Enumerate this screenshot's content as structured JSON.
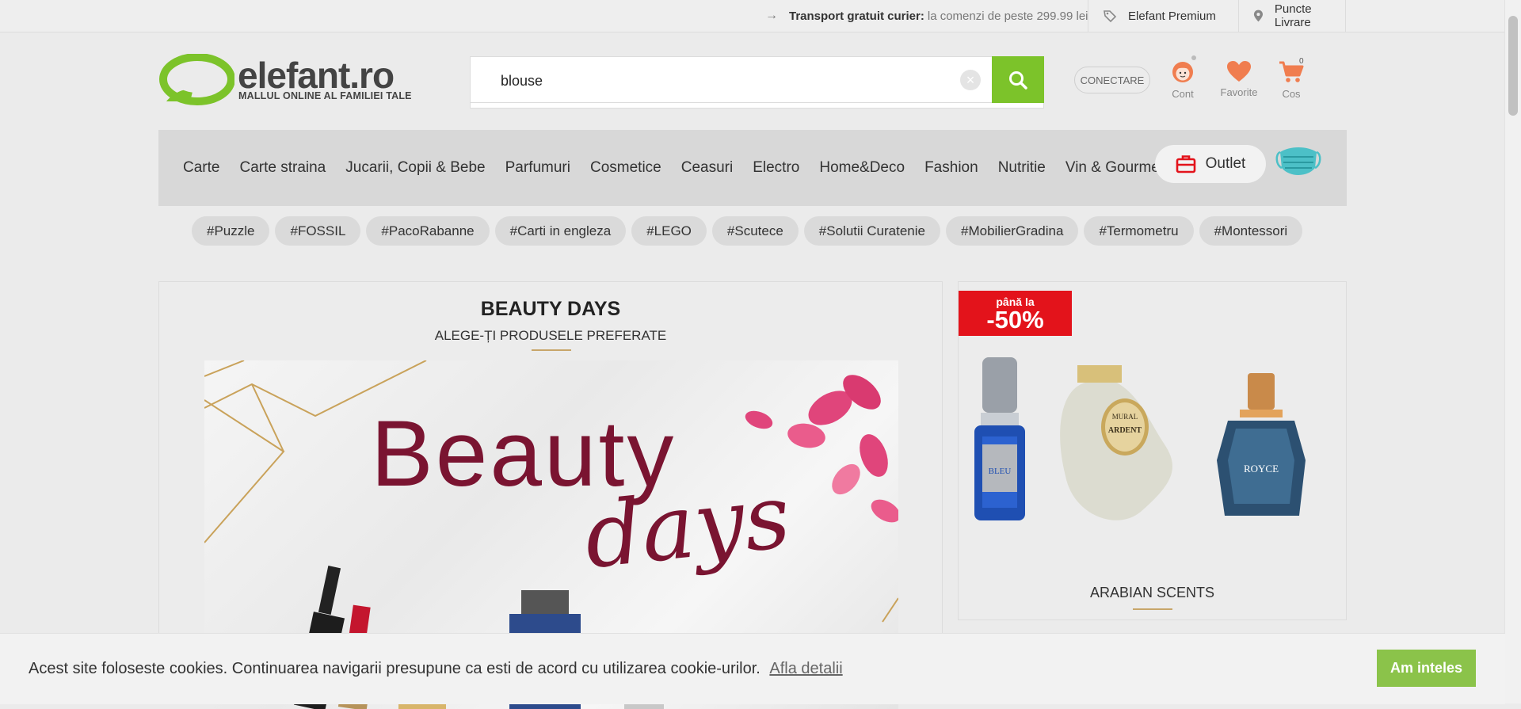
{
  "topbar": {
    "shipping_bold": "Transport gratuit curier:",
    "shipping_text": "la comenzi de peste 299.99 lei",
    "premium": "Elefant Premium",
    "puncte": "Puncte Livrare"
  },
  "logo": {
    "brand": "elefant.ro",
    "tagline": "MALLUL ONLINE AL FAMILIEI TALE"
  },
  "search": {
    "value": "blouse",
    "clear_icon": "×"
  },
  "user": {
    "conectare": "CONECTARE",
    "cont": "Cont",
    "favorite": "Favorite",
    "cos": "Cos",
    "cart_count": "0"
  },
  "nav": {
    "items": [
      "Carte",
      "Carte straina",
      "Jucarii, Copii & Bebe",
      "Parfumuri",
      "Cosmetice",
      "Ceasuri",
      "Electro",
      "Home&Deco",
      "Fashion",
      "Nutritie",
      "Vin & Gourmet"
    ],
    "outlet": "Outlet"
  },
  "tags": [
    "#Puzzle",
    "#FOSSIL",
    "#PacoRabanne",
    "#Carti in engleza",
    "#LEGO",
    "#Scutece",
    "#Solutii Curatenie",
    "#MobilierGradina",
    "#Termometru",
    "#Montessori"
  ],
  "left_panel": {
    "title": "BEAUTY DAYS",
    "subtitle": "ALEGE-ȚI PRODUSELE PREFERATE",
    "hero_word1": "Beauty",
    "hero_word2": "days"
  },
  "right_panel": {
    "promo_top": "până la",
    "promo_value": "-50%",
    "caption": "ARABIAN SCENTS",
    "bottle1_label": "BLEU",
    "bottle2_label1": "MURAL",
    "bottle2_label2": "ARDENT",
    "bottle3_label": "ROYCE"
  },
  "cookie": {
    "message": "Acest site foloseste cookies. Continuarea navigarii presupune ca esti de acord cu utilizarea cookie-urilor.",
    "link": "Afla detalii",
    "button": "Am inteles"
  },
  "colors": {
    "brand_green": "#7cc32a",
    "cookie_button": "#8bc34a",
    "promo_red": "#e3131b",
    "user_icon": "#f07d4f",
    "accent_gold": "#c8a66a"
  },
  "icons": [
    "arrow-right-icon",
    "tag-icon",
    "location-pin-icon",
    "search-icon",
    "user-face-icon",
    "heart-icon",
    "cart-icon",
    "briefcase-icon",
    "face-mask-icon"
  ]
}
